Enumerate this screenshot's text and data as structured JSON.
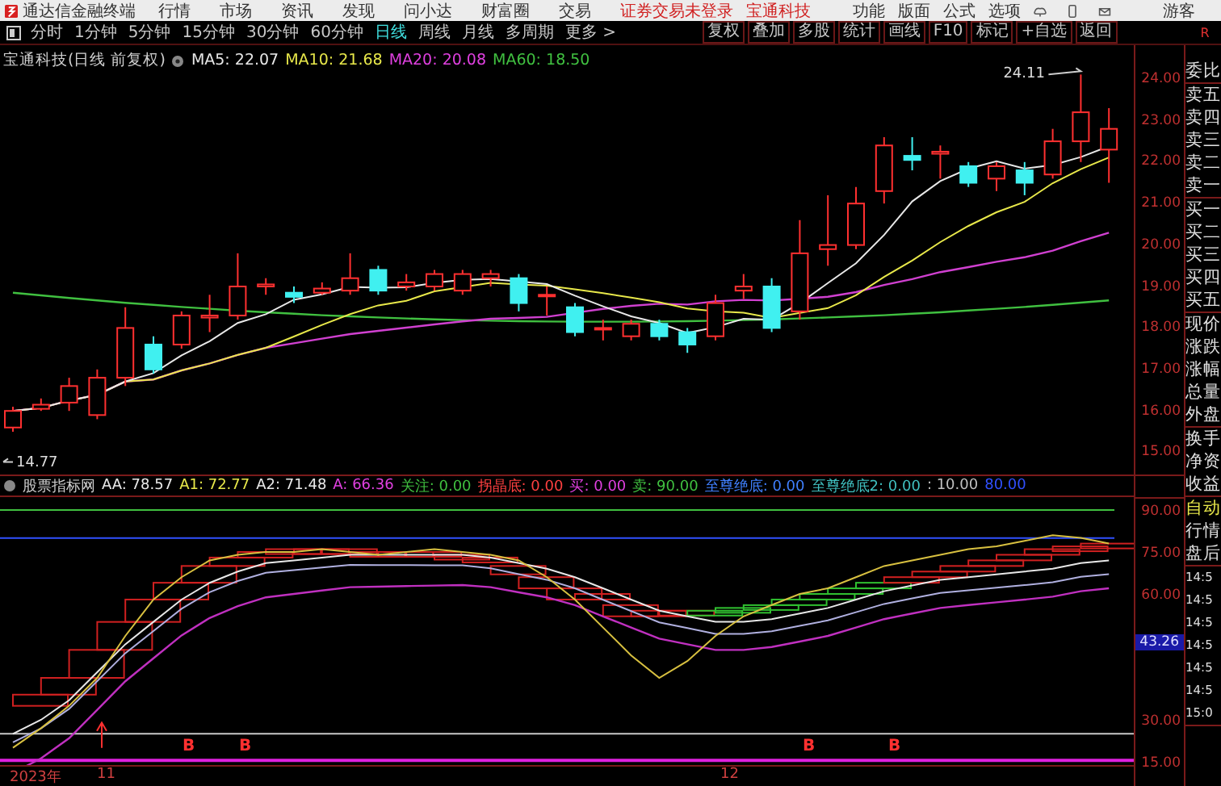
{
  "title_bar": {
    "app_name": "通达信金融终端",
    "menus": [
      "行情",
      "市场",
      "资讯",
      "发现",
      "问小达",
      "财富圈",
      "交易"
    ],
    "notice": "证券交易未登录",
    "stock_link": "宝通科技",
    "tools": [
      "功能",
      "版面",
      "公式",
      "选项"
    ],
    "user": "游客"
  },
  "toolbar": {
    "periods": [
      {
        "label": "分时",
        "selected": false
      },
      {
        "label": "1分钟",
        "selected": false
      },
      {
        "label": "5分钟",
        "selected": false
      },
      {
        "label": "15分钟",
        "selected": false
      },
      {
        "label": "30分钟",
        "selected": false
      },
      {
        "label": "60分钟",
        "selected": false
      },
      {
        "label": "日线",
        "selected": true
      },
      {
        "label": "周线",
        "selected": false
      },
      {
        "label": "月线",
        "selected": false
      },
      {
        "label": "多周期",
        "selected": false
      }
    ],
    "more": "更多 >",
    "actions": [
      "复权",
      "叠加",
      "多股",
      "统计",
      "画线",
      "F10",
      "标记",
      "+自选",
      "返回"
    ],
    "corner": "R"
  },
  "chart": {
    "stock_title": "宝通科技(日线 前复权)",
    "ma_legend": [
      {
        "label": "MA5: 22.07",
        "color": "#e8e8e8"
      },
      {
        "label": "MA10: 21.68",
        "color": "#e8e84a"
      },
      {
        "label": "MA20: 20.08",
        "color": "#e040e0"
      },
      {
        "label": "MA60: 18.50",
        "color": "#40c040"
      }
    ],
    "high_mark": "24.11",
    "low_mark": "14.77",
    "price_axis": [
      "24.00",
      "23.00",
      "22.00",
      "21.00",
      "20.00",
      "19.00",
      "18.00",
      "17.00",
      "16.00",
      "15.00"
    ]
  },
  "indicator": {
    "name": "股票指标网",
    "values": [
      {
        "label": "AA: 78.57",
        "color": "#e8e8e8"
      },
      {
        "label": "A1: 72.77",
        "color": "#e8e84a"
      },
      {
        "label": "A2: 71.48",
        "color": "#e8e8e8"
      },
      {
        "label": "A: 66.36",
        "color": "#e040e0"
      },
      {
        "label": "关注: 0.00",
        "color": "#40c040"
      },
      {
        "label": "拐晶底: 0.00",
        "color": "#ff4040"
      },
      {
        "label": "买: 0.00",
        "color": "#e040e0"
      },
      {
        "label": "卖: 90.00",
        "color": "#40c040"
      },
      {
        "label": "至尊绝底: 0.00",
        "color": "#4080ff"
      },
      {
        "label": "至尊绝底2: 0.00",
        "color": "#40c0c0"
      },
      {
        "label": ": 10.00",
        "color": "#c0c0c0"
      },
      {
        "label": "80.00",
        "color": "#3050ff"
      }
    ],
    "axis": [
      {
        "label": "90.00",
        "selected": false
      },
      {
        "label": "75.00",
        "selected": false
      },
      {
        "label": "60.00",
        "selected": false
      },
      {
        "label": "43.26",
        "selected": true
      },
      {
        "label": "30.00",
        "selected": false
      },
      {
        "label": "15.00",
        "selected": false
      }
    ],
    "signals": [
      "B",
      "B",
      "B",
      "B"
    ]
  },
  "date_axis": [
    "2023年",
    "11",
    "12"
  ],
  "quote_panel": {
    "sections": [
      {
        "items": [
          {
            "label": "委比"
          }
        ]
      },
      {
        "items": [
          {
            "label": "卖五"
          },
          {
            "label": "卖四"
          },
          {
            "label": "卖三"
          },
          {
            "label": "卖二"
          },
          {
            "label": "卖一"
          }
        ]
      },
      {
        "items": [
          {
            "label": "买一"
          },
          {
            "label": "买二"
          },
          {
            "label": "买三"
          },
          {
            "label": "买四"
          },
          {
            "label": "买五"
          }
        ]
      },
      {
        "items": [
          {
            "label": "现价"
          },
          {
            "label": "涨跌"
          },
          {
            "label": "涨幅"
          },
          {
            "label": "总量"
          },
          {
            "label": "外盘"
          }
        ]
      },
      {
        "items": [
          {
            "label": "换手"
          },
          {
            "label": "净资"
          },
          {
            "label": "收益"
          }
        ]
      },
      {
        "items": [
          {
            "label": "自动",
            "selected": true
          },
          {
            "label": "行情",
            "selected": false
          },
          {
            "label": "盘后",
            "selected": false
          }
        ]
      },
      {
        "items": [
          {
            "label": "14:5"
          },
          {
            "label": "14:5"
          },
          {
            "label": "14:5"
          },
          {
            "label": "14:5"
          },
          {
            "label": "14:5"
          },
          {
            "label": "14:5"
          },
          {
            "label": "15:0"
          }
        ]
      }
    ]
  }
}
